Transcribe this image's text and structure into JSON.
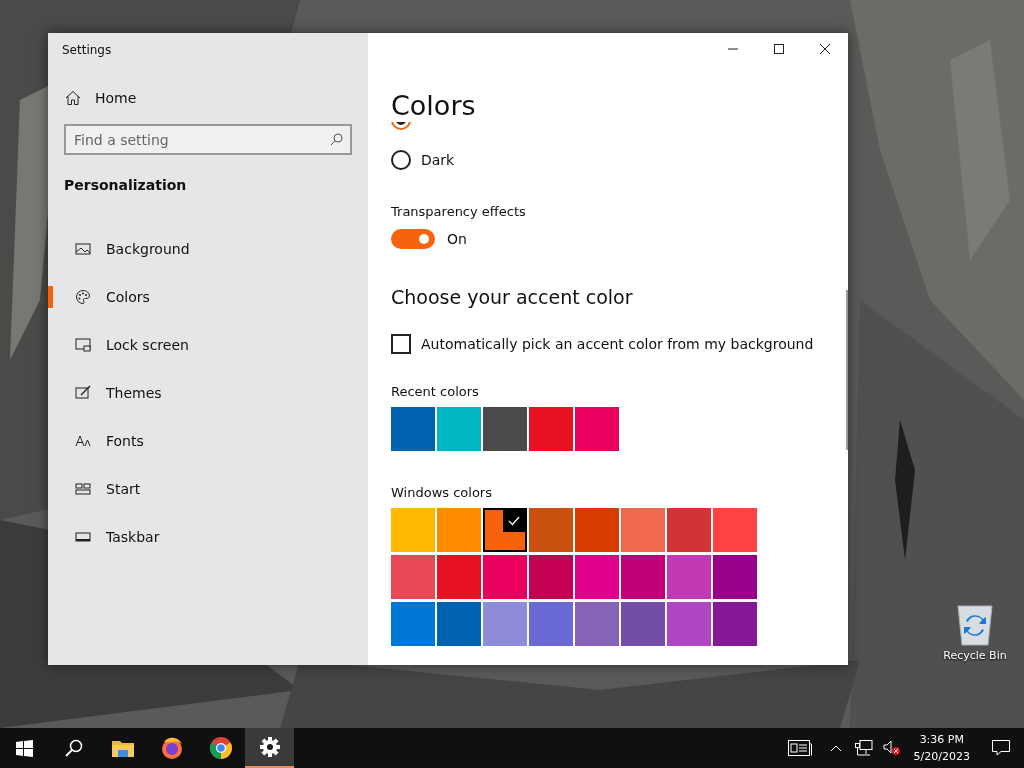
{
  "window": {
    "title": "Settings"
  },
  "sidebar": {
    "home": "Home",
    "search": {
      "placeholder": "Find a setting"
    },
    "section": "Personalization",
    "items": [
      {
        "label": "Background",
        "kind": "background",
        "selected": false
      },
      {
        "label": "Colors",
        "kind": "colors",
        "selected": true
      },
      {
        "label": "Lock screen",
        "kind": "lock",
        "selected": false
      },
      {
        "label": "Themes",
        "kind": "themes",
        "selected": false
      },
      {
        "label": "Fonts",
        "kind": "fonts",
        "selected": false
      },
      {
        "label": "Start",
        "kind": "start",
        "selected": false
      },
      {
        "label": "Taskbar",
        "kind": "taskbar",
        "selected": false
      }
    ]
  },
  "page": {
    "title": "Colors",
    "mode_options": [
      {
        "selected": true
      },
      {
        "label": "Dark",
        "selected": false
      }
    ],
    "transparency": {
      "label": "Transparency effects",
      "on": true,
      "state": "On"
    },
    "accent_heading": "Choose your accent color",
    "auto_accent": {
      "label": "Automatically pick an accent color from my background",
      "checked": false
    },
    "recent_label": "Recent colors",
    "recent_colors": [
      {
        "color": "#0063b1"
      },
      {
        "color": "#00b7c3"
      },
      {
        "color": "#4c4a48"
      },
      {
        "color": "#e81123"
      },
      {
        "color": "#ea005e"
      }
    ],
    "windows_label": "Windows colors",
    "windows_colors": [
      {
        "color": "#ffb900",
        "selected": false
      },
      {
        "color": "#ff8c00",
        "selected": false
      },
      {
        "color": "#f7630c",
        "selected": true
      },
      {
        "color": "#ca5010",
        "selected": false
      },
      {
        "color": "#da3b01",
        "selected": false
      },
      {
        "color": "#ef6950",
        "selected": false
      },
      {
        "color": "#d13438",
        "selected": false
      },
      {
        "color": "#ff4343",
        "selected": false
      },
      {
        "color": "#e74856",
        "selected": false
      },
      {
        "color": "#e81123",
        "selected": false
      },
      {
        "color": "#ea005e",
        "selected": false
      },
      {
        "color": "#c30052",
        "selected": false
      },
      {
        "color": "#e3008c",
        "selected": false
      },
      {
        "color": "#bf0077",
        "selected": false
      },
      {
        "color": "#c239b3",
        "selected": false
      },
      {
        "color": "#9a0089",
        "selected": false
      },
      {
        "color": "#0078d7",
        "selected": false
      },
      {
        "color": "#0063b1",
        "selected": false
      },
      {
        "color": "#8e8cd8",
        "selected": false
      },
      {
        "color": "#6b69d6",
        "selected": false
      },
      {
        "color": "#8764b8",
        "selected": false
      },
      {
        "color": "#744da9",
        "selected": false
      },
      {
        "color": "#b146c2",
        "selected": false
      },
      {
        "color": "#881798",
        "selected": false
      }
    ]
  },
  "desktop": {
    "icons": [
      {
        "label": "Recycle Bin"
      }
    ]
  },
  "taskbar": {
    "apps": [
      {
        "kind": "start",
        "selected": false
      },
      {
        "kind": "search",
        "selected": false
      },
      {
        "kind": "explorer",
        "selected": false
      },
      {
        "kind": "firefox",
        "selected": false
      },
      {
        "kind": "chrome",
        "selected": false
      },
      {
        "kind": "settings",
        "selected": true
      }
    ],
    "time": "3:36 PM",
    "date": "5/20/2023"
  }
}
